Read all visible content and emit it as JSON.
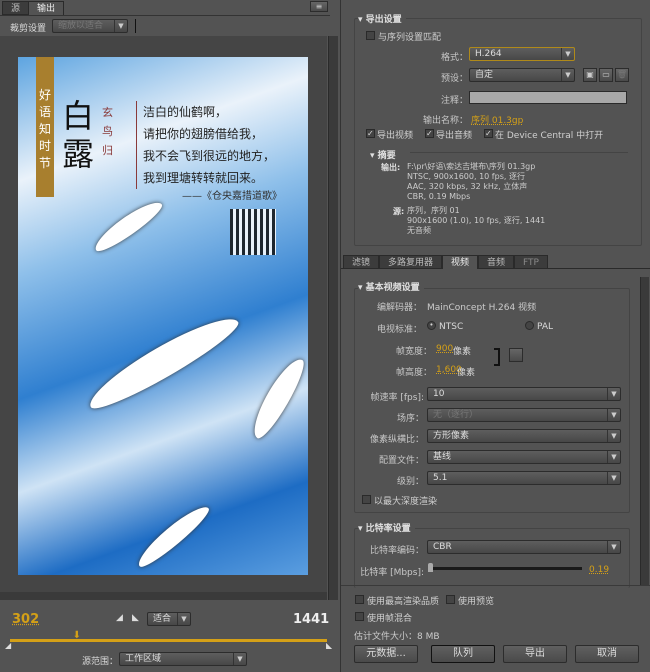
{
  "left_panel": {
    "tabs": [
      "源",
      "输出"
    ],
    "crop_label": "裁剪设置",
    "crop_dropdown": "缩放以适合",
    "preview": {
      "side_banner": "好语知时节",
      "title": "白露",
      "subtitle": "玄鸟归",
      "poem": [
        "洁白的仙鹤啊，",
        "请把你的翅膀借给我，",
        "我不会飞到很远的地方，",
        "我到理塘转转就回来。"
      ],
      "source": "——《仓央嘉措道歌》"
    },
    "current_frame": "302",
    "zoom_dropdown": "适合",
    "end_frame": "1441",
    "playhead_fraction": 0.21,
    "source_range_label": "源范围：",
    "source_range_value": "工作区域"
  },
  "export_settings": {
    "header": "导出设置",
    "match_sequence": "与序列设置匹配",
    "format_label": "格式：",
    "format_value": "H.264",
    "preset_label": "预设：",
    "preset_value": "自定",
    "comment_label": "注释：",
    "comment_value": "",
    "output_name_label": "输出名称：",
    "output_name_value": "序列 01.3gp",
    "export_video": "导出视频",
    "export_audio": "导出音频",
    "open_device_central": "在 Device Central 中打开",
    "summary_header": "摘要",
    "output_label": "输出:",
    "output_lines": [
      "F:\\pr\\好语\\索达吉堪布\\序列 01.3gp",
      "NTSC, 900x1600, 10 fps, 逐行",
      "AAC, 320 kbps, 32 kHz, 立体声",
      "CBR, 0.19 Mbps"
    ],
    "source_label": "源:",
    "source_lines": [
      "序列，序列 01",
      "900x1600 (1.0), 10 fps, 逐行, 1441",
      "无音频"
    ]
  },
  "settings_tabs": [
    "滤镜",
    "多路复用器",
    "视频",
    "音频",
    "FTP"
  ],
  "video": {
    "basic_header": "基本视频设置",
    "codec_label": "编解码器：",
    "codec_value": "MainConcept H.264 视频",
    "tv_label": "电视标准：",
    "ntsc": "NTSC",
    "pal": "PAL",
    "width_label": "帧宽度：",
    "width_value": "900",
    "height_label": "帧高度：",
    "height_value": "1,600",
    "unit": "像素",
    "fps_label": "帧速率 [fps]:",
    "fps_value": "10",
    "field_label": "场序：",
    "field_value": "无（逐行）",
    "par_label": "像素纵横比：",
    "par_value": "方形像素",
    "profile_label": "配置文件：",
    "profile_value": "基线",
    "level_label": "级别：",
    "level_value": "5.1",
    "max_depth": "以最大深度渲染",
    "bitrate_header": "比特率设置",
    "bitrate_enc_label": "比特率编码：",
    "bitrate_enc_value": "CBR",
    "bitrate_label": "比特率 [Mbps]:",
    "bitrate_value": "0.19"
  },
  "bottom": {
    "max_quality": "使用最高渲染品质",
    "use_preview": "使用预览",
    "frame_blend": "使用帧混合",
    "file_size": "估计文件大小：8 MB",
    "buttons": [
      "元数据...",
      "队列",
      "导出",
      "取消"
    ]
  }
}
